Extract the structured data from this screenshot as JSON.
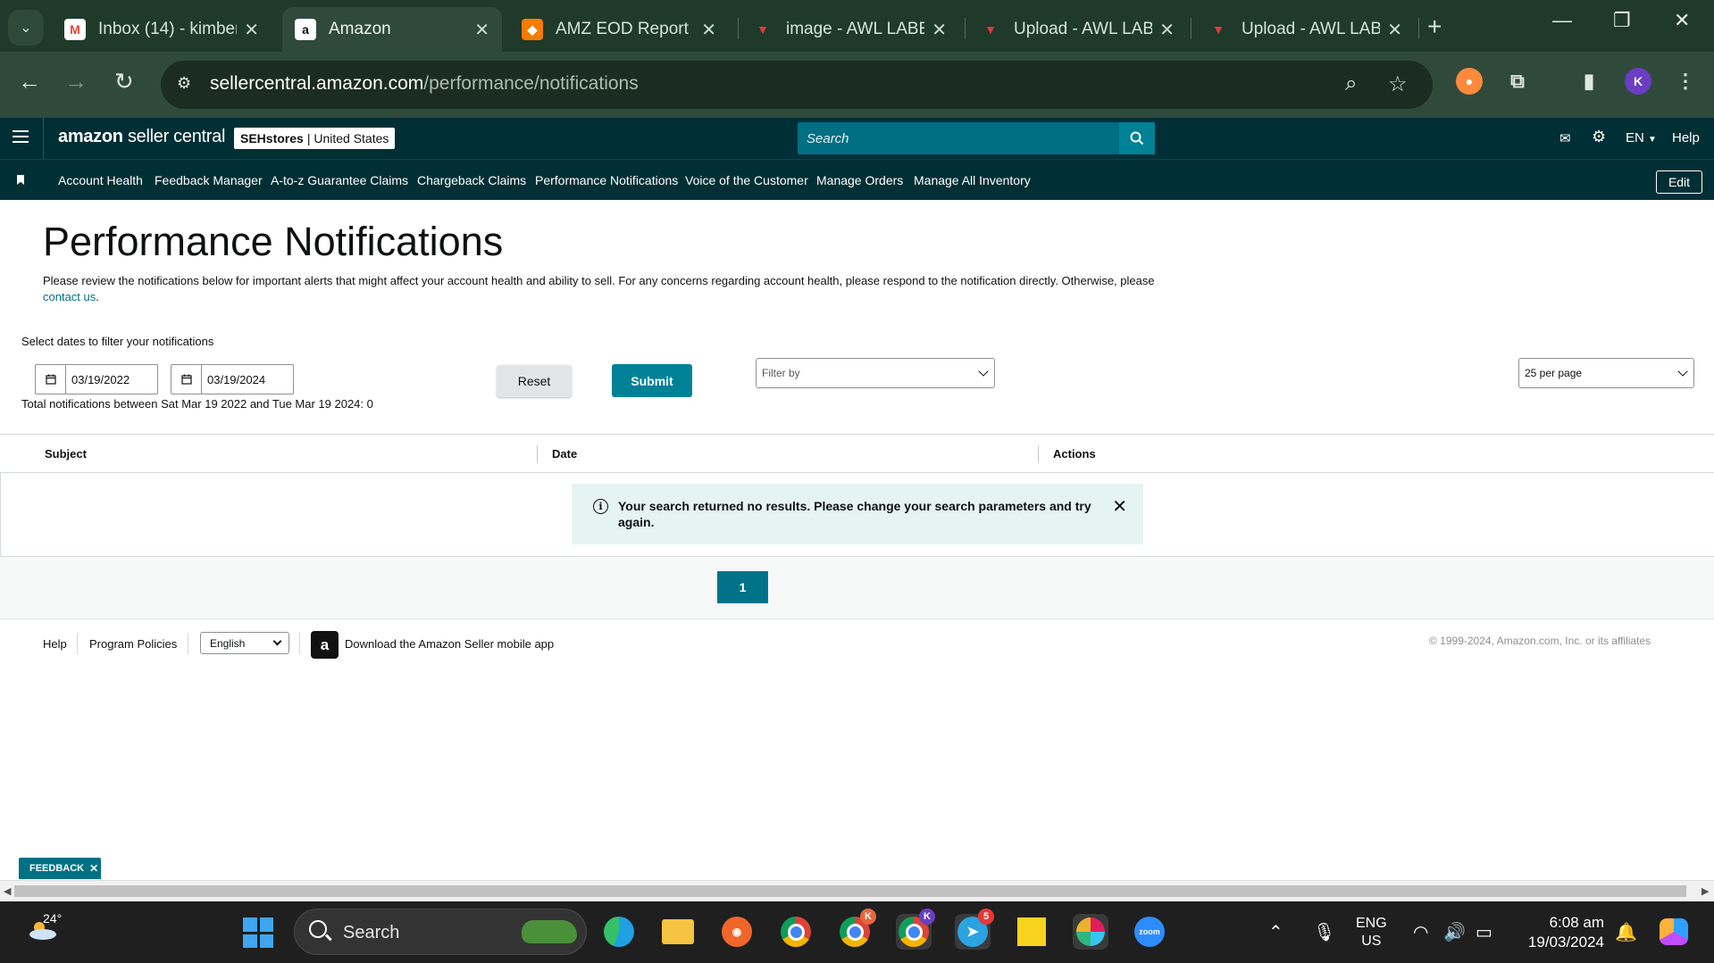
{
  "browser": {
    "tabs": [
      {
        "label": "Inbox (14) - kimber",
        "favicon": "gmail-icon",
        "active": false
      },
      {
        "label": "Amazon",
        "favicon": "amazon-icon",
        "active": true
      },
      {
        "label": "AMZ EOD Report",
        "favicon": "report-icon",
        "active": false
      },
      {
        "label": "image - AWL LABE",
        "favicon": "awl-icon",
        "active": false
      },
      {
        "label": "Upload - AWL LAB",
        "favicon": "awl-icon",
        "active": false
      },
      {
        "label": "Upload - AWL LAB",
        "favicon": "awl-icon",
        "active": false
      }
    ],
    "url_domain": "sellercentral.amazon.com",
    "url_path": "/performance/notifications",
    "profile_initial": "K"
  },
  "header": {
    "logo_brand": "amazon",
    "logo_product": "seller central",
    "store_name": "SEHstores",
    "store_region": "| United States",
    "search_placeholder": "Search",
    "language": "EN",
    "help": "Help"
  },
  "nav": {
    "links": [
      "Account Health",
      "Feedback Manager",
      "A-to-z Guarantee Claims",
      "Chargeback Claims",
      "Performance Notifications",
      "Voice of the Customer",
      "Manage Orders",
      "Manage All Inventory"
    ],
    "edit": "Edit"
  },
  "page": {
    "title": "Performance Notifications",
    "description": "Please review the notifications below for important alerts that might affect your account health and ability to sell. For any concerns regarding account health, please respond to the notification directly. Otherwise, please",
    "contact_link": "contact us",
    "filter_label": "Select dates to filter your notifications",
    "start_date": "03/19/2022",
    "end_date": "03/19/2024",
    "total_text": "Total notifications between Sat Mar 19 2022 and Tue Mar 19 2024: 0",
    "reset": "Reset",
    "submit": "Submit",
    "filter_placeholder": "Filter by",
    "per_page": "25 per page"
  },
  "table": {
    "columns": [
      "Subject",
      "Date",
      "Actions"
    ],
    "empty_message": "Your search returned no results. Please change your search parameters and try again."
  },
  "pagination": {
    "current_page": "1"
  },
  "footer": {
    "help": "Help",
    "policies": "Program Policies",
    "language": "English",
    "app_text": "Download the Amazon Seller mobile app",
    "copyright": "© 1999-2024, Amazon.com, Inc. or its affiliates"
  },
  "feedback": "FEEDBACK",
  "taskbar": {
    "temperature": "24°",
    "search_label": "Search",
    "telegram_badge": "5",
    "lang_line1": "ENG",
    "lang_line2": "US",
    "time": "6:08 am",
    "date": "19/03/2024"
  },
  "colors": {
    "header_bg": "#002f36",
    "accent_teal": "#008296",
    "link": "#007185",
    "alert_bg": "#e6f3f3"
  }
}
